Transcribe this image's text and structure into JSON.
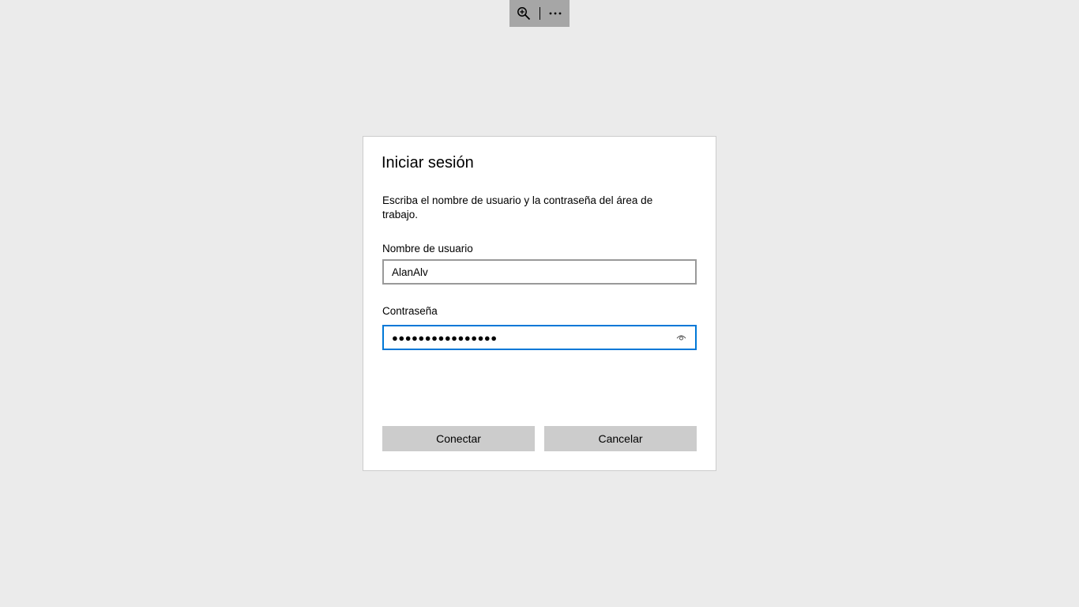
{
  "toolbar": {
    "zoom_icon": "zoom-in-icon",
    "more_icon": "more-icon",
    "more_label": "···"
  },
  "dialog": {
    "title": "Iniciar sesión",
    "description": "Escriba el nombre de usuario y la contraseña del área de trabajo.",
    "username_label": "Nombre de usuario",
    "username_value": "AlanAlv",
    "password_label": "Contraseña",
    "password_masked": "●●●●●●●●●●●●●●●●",
    "reveal_icon": "eye-icon",
    "connect_label": "Conectar",
    "cancel_label": "Cancelar"
  },
  "colors": {
    "background": "#ebebeb",
    "toolbar": "#a6a6a6",
    "focus_border": "#0078d7",
    "button": "#cccccc"
  }
}
